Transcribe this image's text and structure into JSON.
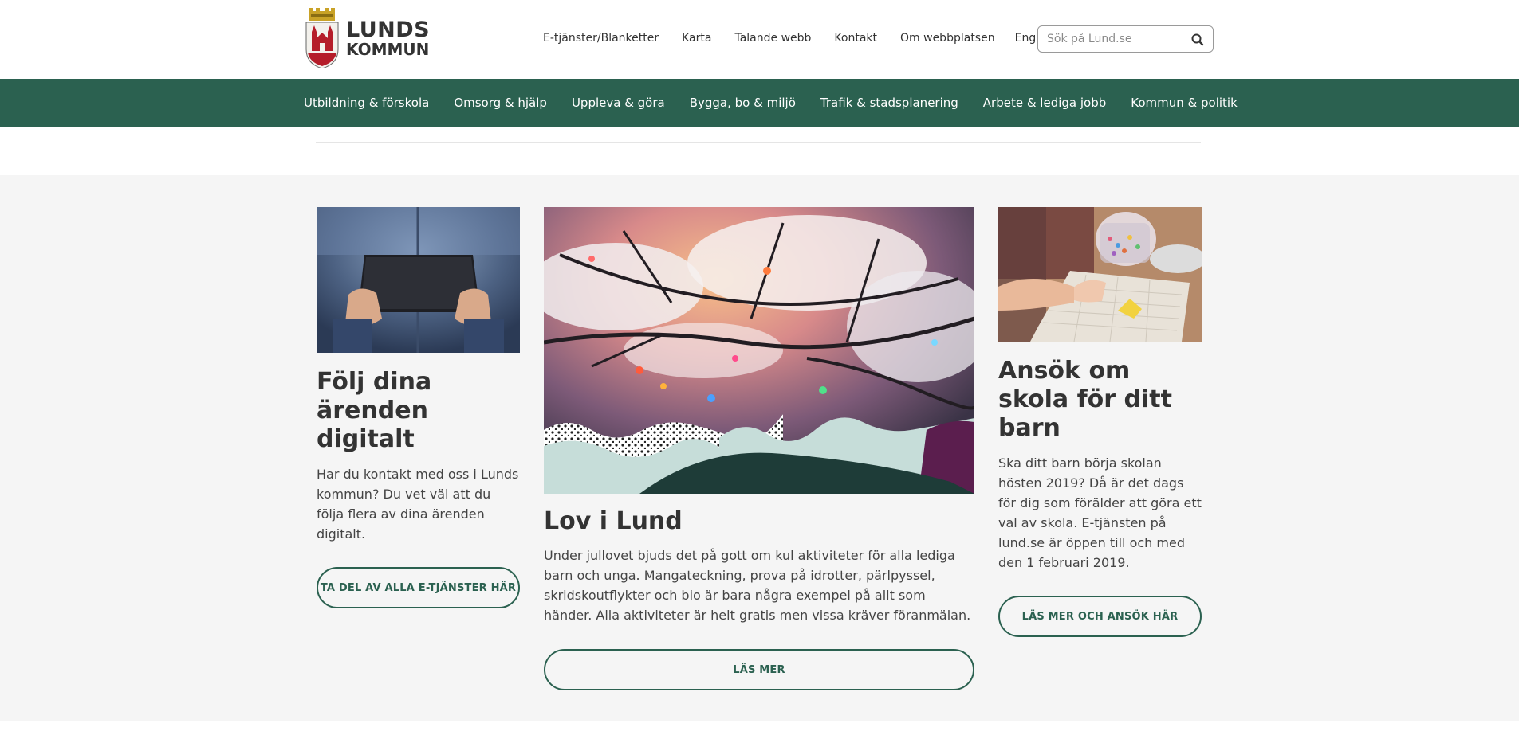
{
  "brand": {
    "line1": "LUNDS",
    "line2": "KOMMUN",
    "accent": "#2b6150"
  },
  "util_nav": [
    "E-tjänster/Blanketter",
    "Karta",
    "Talande webb",
    "Kontakt",
    "Om webbplatsen",
    "Engelska"
  ],
  "search": {
    "placeholder": "Sök på Lund.se",
    "icon": "search-icon"
  },
  "main_nav": [
    "Utbildning & förskola",
    "Omsorg & hjälp",
    "Uppleva & göra",
    "Bygga, bo & miljö",
    "Trafik & stadsplanering",
    "Arbete & lediga jobb",
    "Kommun & politik"
  ],
  "cards": [
    {
      "title": "Följ dina ärenden digitalt",
      "text": "Har du kontakt med oss i Lunds kommun? Du vet väl att du följa flera av dina ärenden digitalt.",
      "button": "TA DEL AV ALLA E-TJÄNSTER HÄR",
      "image": "tablet-hands-image"
    },
    {
      "title": "Lov i Lund",
      "text": "Under jullovet bjuds det på gott om kul aktiviteter för alla lediga barn och unga. Mangateckning, prova på idrotter, pärlpyssel, skridskoutflykter och bio är bara några exempel på allt som händer. Alla aktiviteter är helt gratis men vissa kräver föranmälan.",
      "button": "LÄS MER",
      "image": "christmas-lights-snow-image"
    },
    {
      "title": "Ansök om skola för ditt barn",
      "text": "Ska ditt barn börja skolan hösten 2019? Då är det dags för dig som förälder att göra ett val av skola. E-tjänsten på lund.se är öppen till och med den 1 februari 2019.",
      "button": "LÄS MER OCH ANSÖK HÄR",
      "image": "child-beads-image"
    }
  ]
}
